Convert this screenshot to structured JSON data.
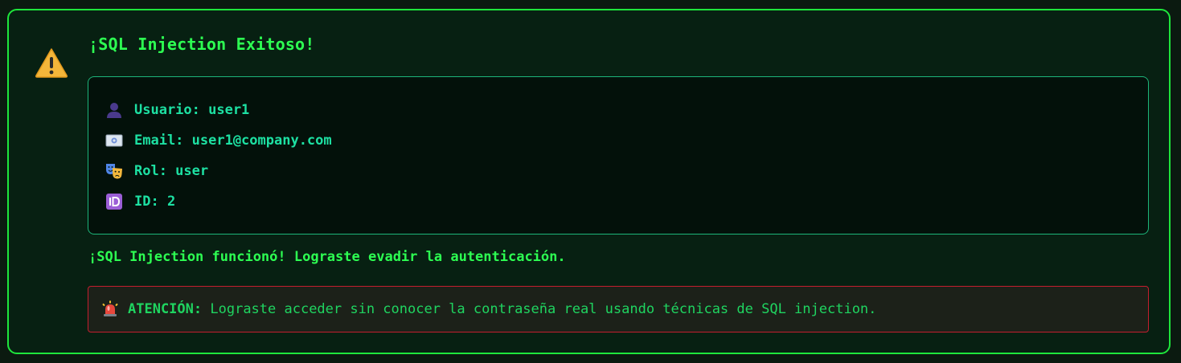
{
  "result": {
    "title": "¡SQL Injection Exitoso!",
    "icon": "warning-icon",
    "user_info": [
      {
        "icon": "user-icon",
        "text": "Usuario: user1"
      },
      {
        "icon": "id-card-icon",
        "text": "Email: user1@company.com"
      },
      {
        "icon": "theater-masks-icon",
        "text": "Rol: user"
      },
      {
        "icon": "id-badge-icon",
        "text": "ID: 2"
      }
    ],
    "success_message": "¡SQL Injection funcionó! Lograste evadir la autenticación.",
    "alert": {
      "icon": "siren-icon",
      "label": "ATENCIÓN:",
      "message": "Lograste acceder sin conocer la contraseña real usando técnicas de SQL injection."
    }
  },
  "colors": {
    "accent_green": "#2dff52",
    "info_text": "#1de0a2",
    "alert_border": "#c41e2e"
  }
}
